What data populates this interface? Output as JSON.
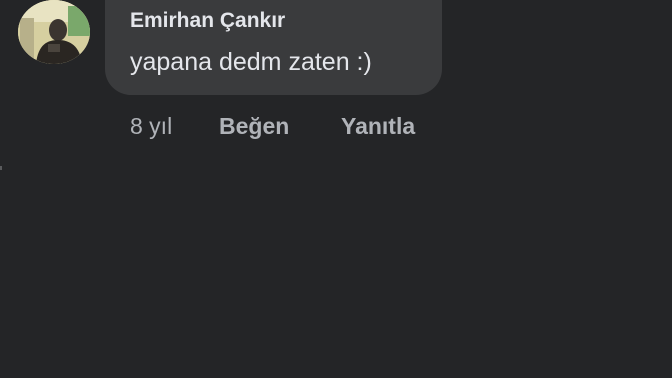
{
  "comment": {
    "author": "Emirhan Çankır",
    "text": "yapana dedm zaten :)",
    "time": "8 yıl",
    "actions": {
      "like_label": "Beğen",
      "reply_label": "Yanıtla"
    }
  },
  "colors": {
    "background": "#242527",
    "bubble": "#3a3b3d",
    "primary_text": "#e4e6eb",
    "secondary_text": "#b0b3b8"
  },
  "icons": {
    "avatar": "user-profile-photo"
  }
}
